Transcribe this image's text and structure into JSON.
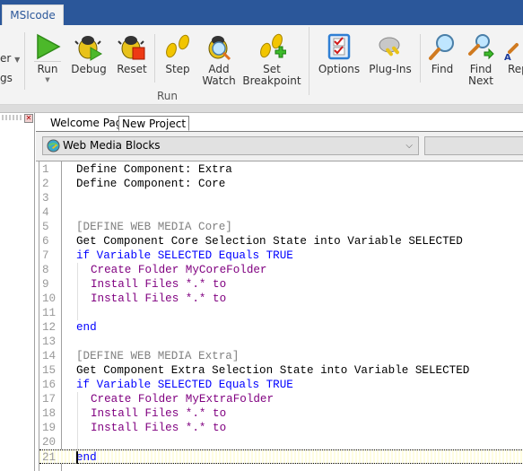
{
  "app": {
    "tab_label": "MSIcode"
  },
  "ribbon": {
    "left_partial": [
      {
        "label": "er",
        "has_dropdown": true
      },
      {
        "label": "gs"
      }
    ],
    "groups": [
      {
        "label": "Run",
        "buttons": [
          {
            "label": "Run",
            "icon": "run-icon",
            "has_dropdown": true
          },
          {
            "label": "Debug",
            "icon": "debug-icon"
          },
          {
            "label": "Reset",
            "icon": "reset-icon"
          },
          {
            "label": "Step",
            "icon": "step-icon"
          },
          {
            "label": "Add\nWatch",
            "icon": "add-watch-icon"
          },
          {
            "label": "Set\nBreakpoint",
            "icon": "set-breakpoint-icon"
          }
        ]
      },
      {
        "label": "",
        "buttons": [
          {
            "label": "Options",
            "icon": "options-icon"
          },
          {
            "label": "Plug-Ins",
            "icon": "plug-ins-icon"
          }
        ]
      },
      {
        "label": "",
        "buttons": [
          {
            "label": "Find",
            "icon": "find-icon"
          },
          {
            "label": "Find\nNext",
            "icon": "find-next-icon"
          },
          {
            "label": "Rep",
            "icon": "replace-icon"
          }
        ]
      }
    ]
  },
  "doc_tabs": [
    {
      "label": "Welcome Page",
      "active": false
    },
    {
      "label": "New Project",
      "active": true
    }
  ],
  "block_selector": {
    "value": "Web Media Blocks",
    "icon": "web-media-globe-icon"
  },
  "editor": {
    "current_line": 21,
    "lines": [
      {
        "n": "1",
        "text": "Define Component: Extra",
        "color": "black",
        "indent": 0
      },
      {
        "n": "2",
        "text": "Define Component: Core",
        "color": "black",
        "indent": 0
      },
      {
        "n": "3",
        "text": "",
        "color": "black",
        "indent": 0
      },
      {
        "n": "4",
        "text": "",
        "color": "black",
        "indent": 0
      },
      {
        "n": "5",
        "text": "[DEFINE WEB MEDIA Core]",
        "color": "gray",
        "indent": 0
      },
      {
        "n": "6",
        "text": "Get Component Core Selection State into Variable SELECTED",
        "color": "black",
        "indent": 0
      },
      {
        "n": "7",
        "text": "if Variable SELECTED Equals TRUE",
        "color": "blue",
        "indent": 0
      },
      {
        "n": "8",
        "text": "Create Folder MyCoreFolder",
        "color": "purple",
        "indent": 1
      },
      {
        "n": "9",
        "text": "Install Files *.* to",
        "color": "purple",
        "indent": 1
      },
      {
        "n": "10",
        "text": "Install Files *.* to",
        "color": "purple",
        "indent": 1
      },
      {
        "n": "11",
        "text": "",
        "color": "black",
        "indent": 0
      },
      {
        "n": "12",
        "text": "end",
        "color": "blue",
        "indent": 0
      },
      {
        "n": "13",
        "text": "",
        "color": "black",
        "indent": 0
      },
      {
        "n": "14",
        "text": "[DEFINE WEB MEDIA Extra]",
        "color": "gray",
        "indent": 0
      },
      {
        "n": "15",
        "text": "Get Component Extra Selection State into Variable SELECTED",
        "color": "black",
        "indent": 0
      },
      {
        "n": "16",
        "text": "if Variable SELECTED Equals TRUE",
        "color": "blue",
        "indent": 0
      },
      {
        "n": "17",
        "text": "Create Folder MyExtraFolder",
        "color": "purple",
        "indent": 1
      },
      {
        "n": "18",
        "text": "Install Files *.* to",
        "color": "purple",
        "indent": 1
      },
      {
        "n": "19",
        "text": "Install Files *.* to",
        "color": "purple",
        "indent": 1
      },
      {
        "n": "20",
        "text": "",
        "color": "black",
        "indent": 0
      },
      {
        "n": "21",
        "text": "end",
        "color": "blue",
        "indent": 0
      }
    ]
  }
}
